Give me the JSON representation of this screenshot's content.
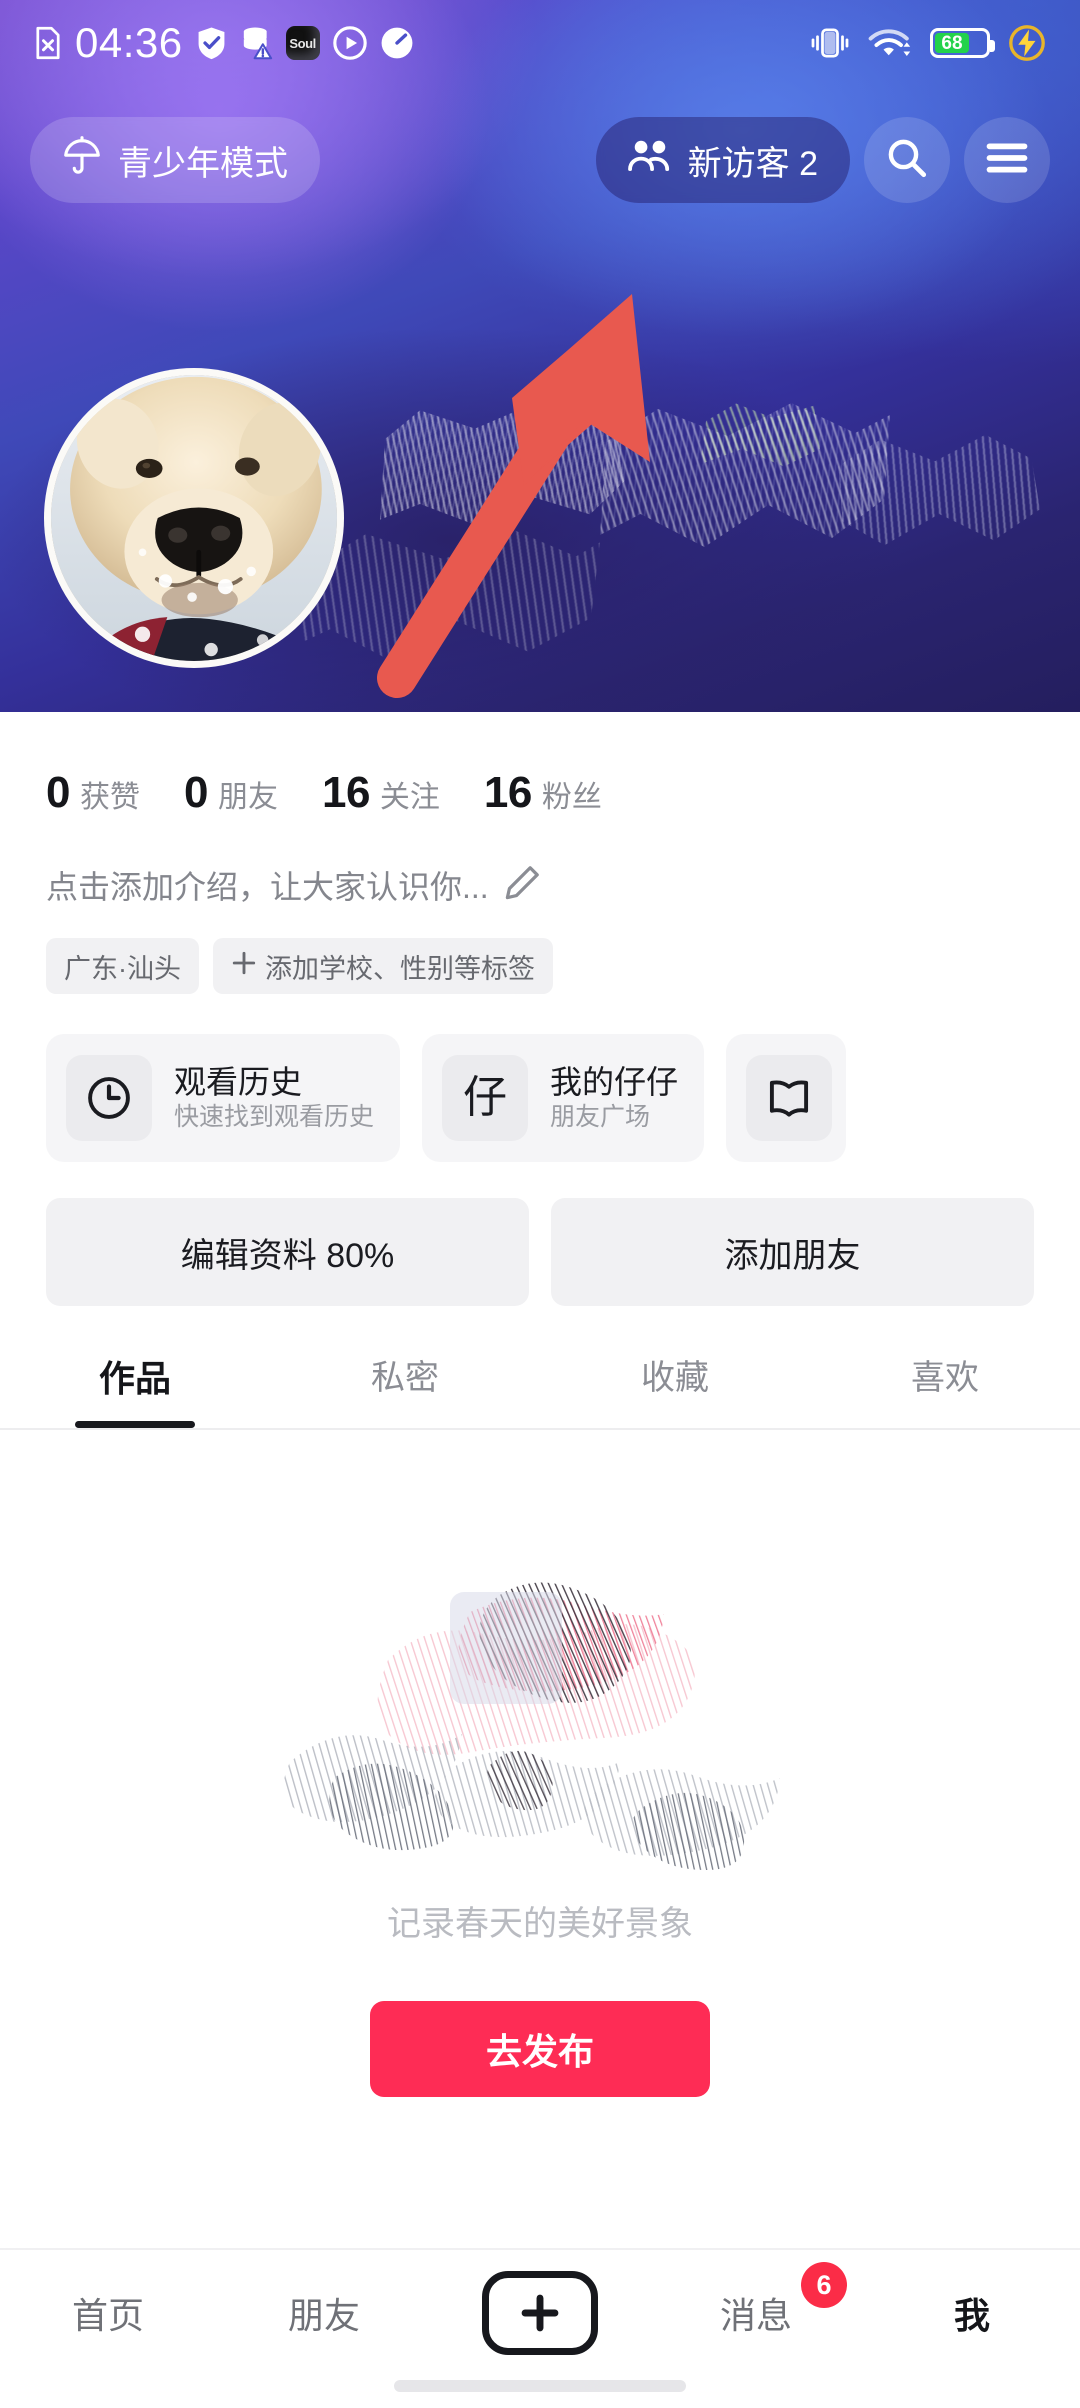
{
  "status_bar": {
    "time": "04:36",
    "left_icons": [
      "no-sim-icon",
      "shield-check-icon",
      "database-warning-icon",
      "soul-app-icon",
      "play-circle-icon",
      "speedometer-icon"
    ],
    "soul_label": "Soul",
    "right_icons": [
      "vibrate-icon",
      "wifi-icon",
      "battery-icon",
      "flash-charge-icon"
    ],
    "battery_level": "68",
    "battery_color": "#23d24b"
  },
  "header": {
    "teen_mode_label": "青少年模式",
    "teen_mode_icon": "umbrella-icon",
    "visitors_label": "新访客 2",
    "visitors_icon": "two-people-icon",
    "search_icon": "search-icon",
    "menu_icon": "hamburger-menu-icon"
  },
  "annotation": {
    "arrow_color": "#e8594f",
    "points_to": "新访客 2"
  },
  "profile": {
    "avatar_name": "golden-retriever-puppy-avatar",
    "stats": [
      {
        "value": "0",
        "label": "获赞"
      },
      {
        "value": "0",
        "label": "朋友"
      },
      {
        "value": "16",
        "label": "关注"
      },
      {
        "value": "16",
        "label": "粉丝"
      }
    ],
    "bio_placeholder": "点击添加介绍，让大家认识你...",
    "bio_edit_icon": "pencil-edit-icon",
    "tags": [
      {
        "label": "广东·汕头",
        "icon": null
      },
      {
        "label": "添加学校、性别等标签",
        "icon": "plus-icon"
      }
    ],
    "cards": [
      {
        "icon": "clock-icon",
        "icon_text": "",
        "title": "观看历史",
        "subtitle": "快速找到观看历史"
      },
      {
        "icon": "zai-char-icon",
        "icon_text": "仔",
        "title": "我的仔仔",
        "subtitle": "朋友广场"
      },
      {
        "icon": "book-icon",
        "icon_text": "",
        "title": "",
        "subtitle": ""
      }
    ],
    "actions": [
      {
        "label": "编辑资料 80%"
      },
      {
        "label": "添加朋友"
      }
    ]
  },
  "tabs": [
    {
      "label": "作品",
      "active": true
    },
    {
      "label": "私密",
      "active": false
    },
    {
      "label": "收藏",
      "active": false
    },
    {
      "label": "喜欢",
      "active": false
    }
  ],
  "empty_state": {
    "text": "记录春天的美好景象",
    "art_name": "paint-strokes-illustration",
    "publish_label": "去发布",
    "publish_color": "#fe2c55"
  },
  "bottom_nav": {
    "items": [
      {
        "label": "首页",
        "active": false,
        "badge": null
      },
      {
        "label": "朋友",
        "active": false,
        "badge": null
      },
      {
        "label": "",
        "active": false,
        "badge": null,
        "icon": "plus-icon"
      },
      {
        "label": "消息",
        "active": false,
        "badge": "6"
      },
      {
        "label": "我",
        "active": true,
        "badge": null
      }
    ],
    "badge_color": "#fb2c47"
  }
}
